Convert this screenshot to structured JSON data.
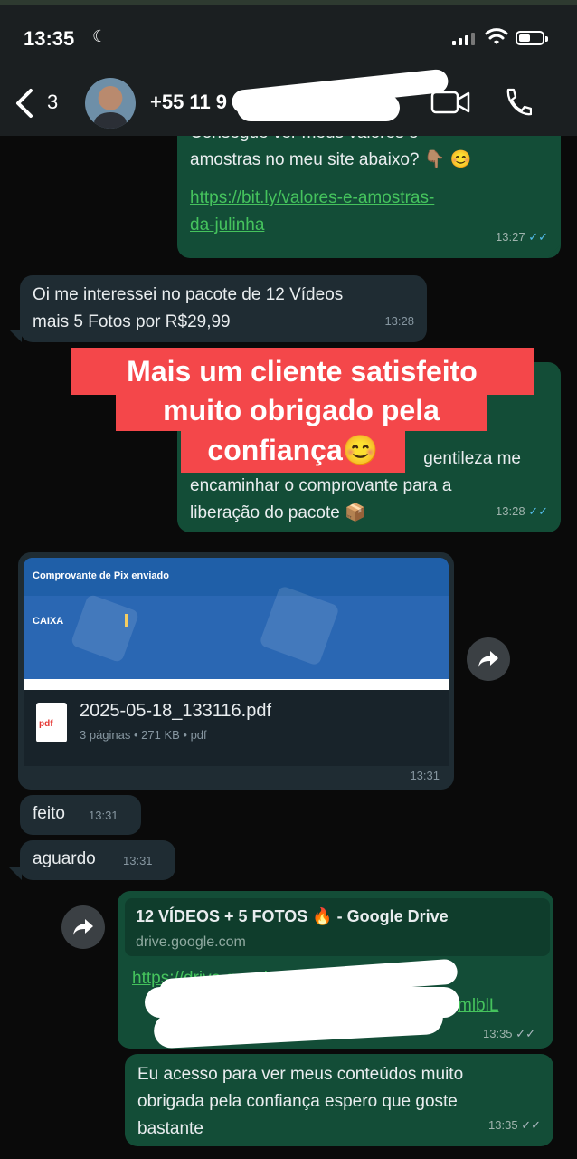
{
  "status_bar": {
    "time": "13:35",
    "moon_icon": "moon-icon"
  },
  "header": {
    "back_count": "3",
    "contact_number": "+55 11 9"
  },
  "messages": {
    "m1": {
      "line1": "Consegue ver meus valores e",
      "line2": "amostras no meu site abaixo? 👇🏽 😊",
      "link_a": "https://bit.ly/valores-e-amostras-",
      "link_b": "da-julinha",
      "time": "13:27"
    },
    "m2": {
      "line1": "Oi me interessei no pacote de 12 Vídeos",
      "line2": "mais 5 Fotos por R$29,99",
      "time": "13:28"
    },
    "m3": {
      "line1": "gentileza me",
      "line2": "encaminhar o comprovante para a",
      "line3": "liberação do pacote 📦",
      "time": "13:28"
    },
    "doc": {
      "preview_title": "Comprovante de Pix enviado",
      "preview_bank": "CAIXA",
      "icon_label": "pdf",
      "filename": "2025-05-18_133116.pdf",
      "meta": "3 páginas • 271 KB • pdf",
      "time": "13:31"
    },
    "m4": {
      "text": "feito",
      "time": "13:31"
    },
    "m5": {
      "text": "aguardo",
      "time": "13:31"
    },
    "m6": {
      "card_title": "12 VÍDEOS + 5 FOTOS 🔥 - Google Drive",
      "card_domain": "drive.google.com",
      "link_a": "https://drive.google.com/drive/folders/",
      "link_b": "mlblL",
      "time": "13:35"
    },
    "m7": {
      "line1": "Eu acesso para ver meus conteúdos muito",
      "line2": "obrigada pela confiança espero que goste",
      "line3": "bastante",
      "time": "13:35"
    }
  },
  "overlay": {
    "line1": "Mais um cliente satisfeito",
    "line2": "muito obrigado pela",
    "line3": "confiança😊"
  },
  "colors": {
    "outgoing": "#134d37",
    "incoming": "#1f2c33",
    "overlay": "#f4474a",
    "link": "#45c35d",
    "read_ticks": "#53bdeb"
  }
}
